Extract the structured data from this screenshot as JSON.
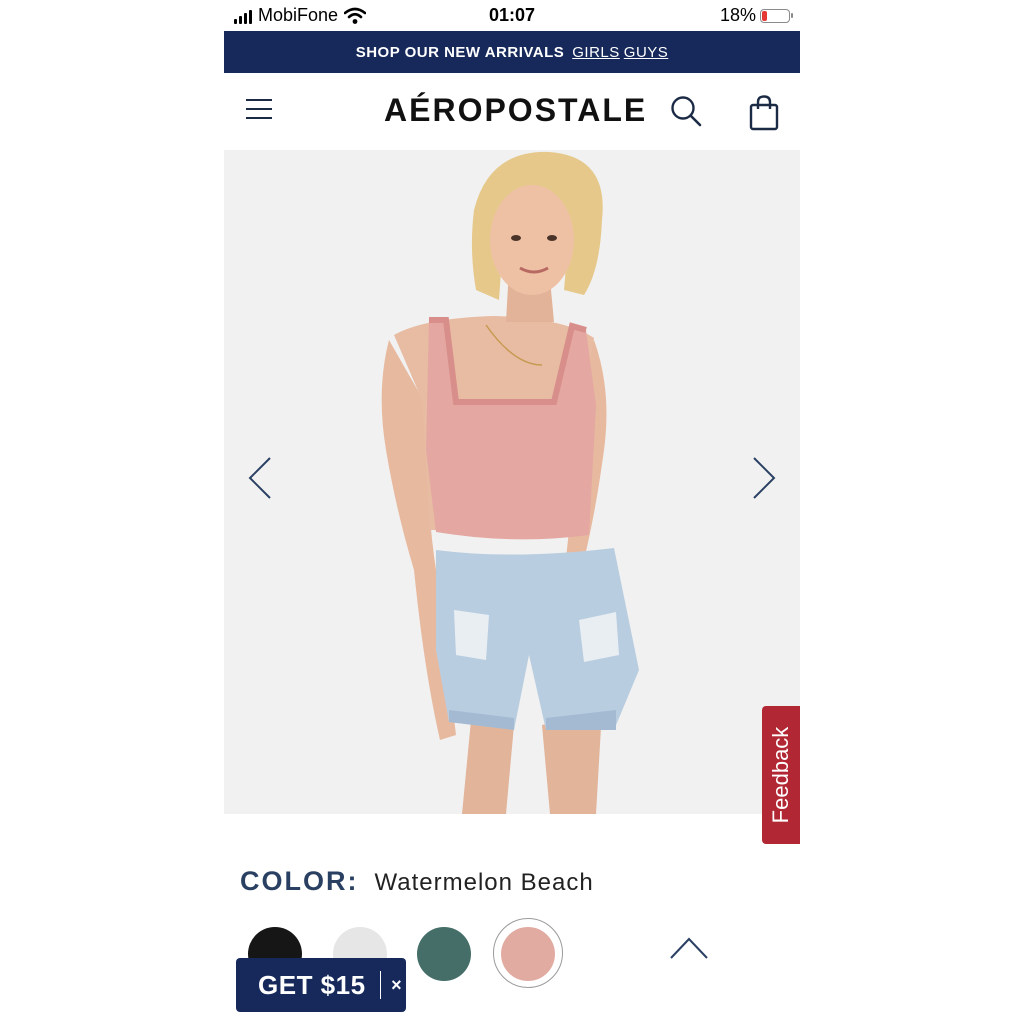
{
  "status_bar": {
    "carrier": "MobiFone",
    "time": "01:07",
    "battery": "18%",
    "battery_level": 0.18
  },
  "promo": {
    "text": "SHOP OUR NEW ARRIVALS",
    "link_girls": "GIRLS",
    "link_guys": "GUYS"
  },
  "header": {
    "logo": "AÉROPOSTALE",
    "icons": [
      "menu-icon",
      "search-icon",
      "shopping-bag-icon"
    ]
  },
  "gallery": {
    "icons": [
      "chevron-left-icon",
      "chevron-right-icon"
    ]
  },
  "feedback": {
    "label": "Feedback"
  },
  "product": {
    "color_label": "COLOR:",
    "color_value": "Watermelon Beach",
    "swatches": [
      {
        "color": "#161616",
        "selected": false
      },
      {
        "color": "#e6e6e6",
        "selected": false
      },
      {
        "color": "#456e68",
        "selected": false
      },
      {
        "color": "#e2aba1",
        "selected": true
      }
    ]
  },
  "promo_pill": {
    "label": "GET $15",
    "close": "×"
  },
  "colors": {
    "navy": "#16295a",
    "feedback_red": "#b22734",
    "label_blue": "#2a4063"
  }
}
